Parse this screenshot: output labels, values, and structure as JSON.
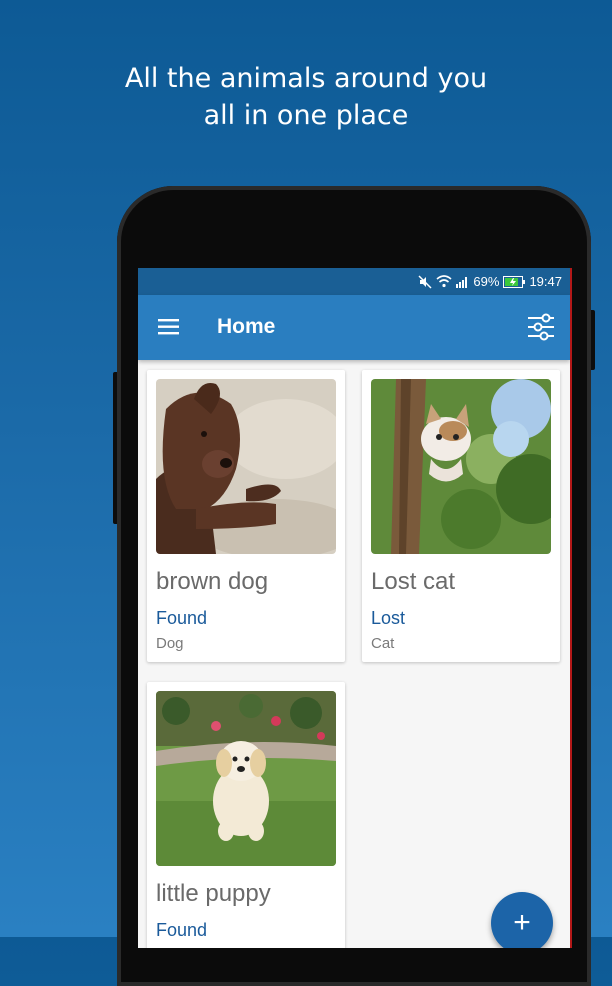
{
  "promo": {
    "line1": "All the animals around you",
    "line2": "all in one place"
  },
  "statusbar": {
    "battery": "69%",
    "time": "19:47",
    "icons": [
      "mute-icon",
      "wifi-icon",
      "signal-icon",
      "battery-charging-icon"
    ]
  },
  "appbar": {
    "title": "Home",
    "left_icon": "hamburger-menu-icon",
    "right_icon": "filter-sliders-icon"
  },
  "cards": [
    {
      "title": "brown dog",
      "status": "Found",
      "type": "Dog",
      "image": "brown labrador lying on sand"
    },
    {
      "title": "Lost cat",
      "status": "Lost",
      "type": "Cat",
      "image": "kitten climbing a tree"
    },
    {
      "title": "little puppy",
      "status": "Found",
      "type": "",
      "image": "golden retriever puppy on grass"
    }
  ],
  "fab": {
    "label": "+",
    "icon": "add-icon"
  },
  "colors": {
    "background": "#1b6aa8",
    "appbar": "#2a7ec0",
    "statusbar": "#1a5f95",
    "status_text": "#1a5a9a",
    "fab": "#1c64a8"
  }
}
